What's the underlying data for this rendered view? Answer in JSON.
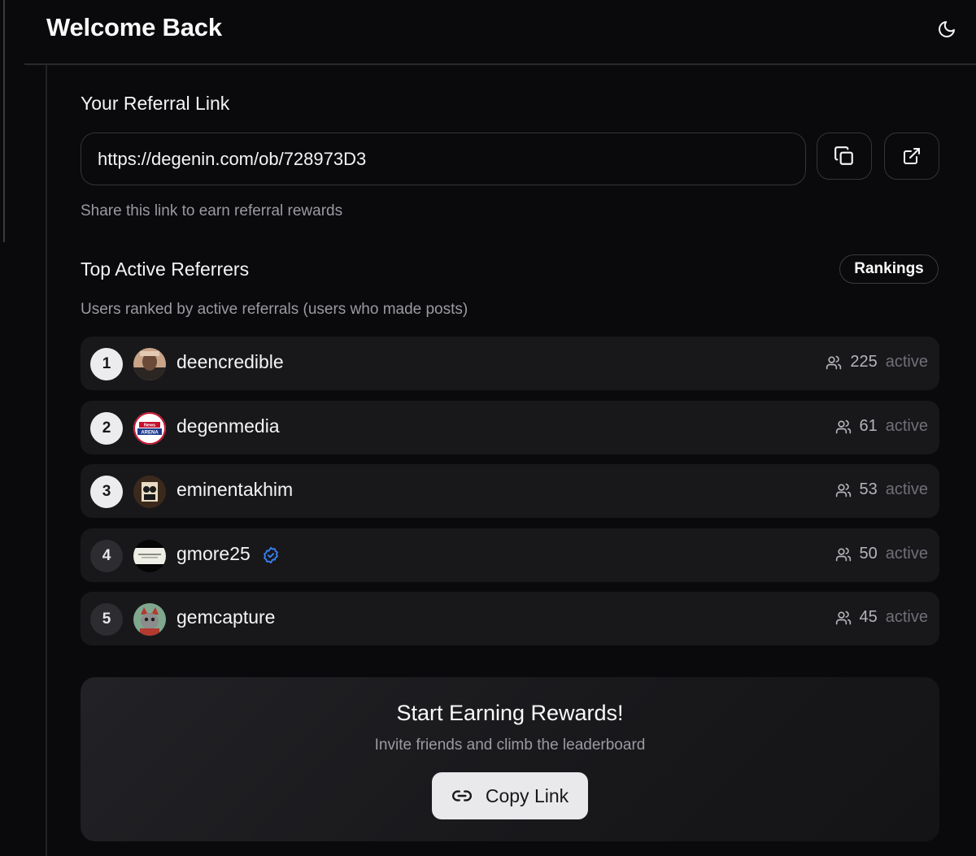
{
  "header": {
    "title": "Welcome Back",
    "theme_icon": "moon-icon"
  },
  "referral": {
    "title": "Your Referral Link",
    "link": "https://degenin.com/ob/728973D3",
    "copy_icon": "copy-icon",
    "open_icon": "external-link-icon",
    "hint": "Share this link to earn referral rewards"
  },
  "leaderboard": {
    "title": "Top Active Referrers",
    "rankings_label": "Rankings",
    "subtitle": "Users ranked by active referrals (users who made posts)",
    "unit_label": "active",
    "rows": [
      {
        "rank": "1",
        "username": "deencredible",
        "count": "225",
        "verified": false
      },
      {
        "rank": "2",
        "username": "degenmedia",
        "count": "61",
        "verified": false,
        "avatar_text_top": "News",
        "avatar_text_bottom": "ARENA"
      },
      {
        "rank": "3",
        "username": "eminentakhim",
        "count": "53",
        "verified": false
      },
      {
        "rank": "4",
        "username": "gmore25",
        "count": "50",
        "verified": true
      },
      {
        "rank": "5",
        "username": "gemcapture",
        "count": "45",
        "verified": false
      }
    ]
  },
  "cta": {
    "title": "Start Earning Rewards!",
    "subtitle": "Invite friends and climb the leaderboard",
    "button_label": "Copy Link",
    "button_icon": "link-icon"
  },
  "colors": {
    "background": "#0a0a0c",
    "row_background": "#18181b",
    "verified_blue": "#3b82f6",
    "button_light": "#e9e9eb"
  }
}
